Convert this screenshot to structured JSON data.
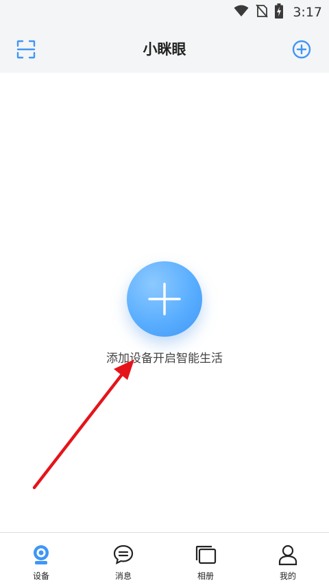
{
  "status_bar": {
    "time": "3:17",
    "icons": [
      "wifi-icon",
      "no-sim-icon",
      "battery-charging-icon"
    ]
  },
  "header": {
    "title": "小眯眼",
    "left_icon": "scan-icon",
    "right_icon": "add-circle-icon"
  },
  "main": {
    "add_button_icon": "plus-icon",
    "empty_hint": "添加设备开启智能生活",
    "annotation": "red-arrow"
  },
  "bottom_nav": {
    "items": [
      {
        "label": "设备",
        "icon": "camera-icon",
        "active": true
      },
      {
        "label": "消息",
        "icon": "chat-bubble-icon",
        "active": false
      },
      {
        "label": "相册",
        "icon": "album-icon",
        "active": false
      },
      {
        "label": "我的",
        "icon": "person-icon",
        "active": false
      }
    ]
  },
  "colors": {
    "accent": "#3f96f5",
    "header_bg": "#f4f5f7",
    "annotation_arrow": "#e5141a"
  }
}
